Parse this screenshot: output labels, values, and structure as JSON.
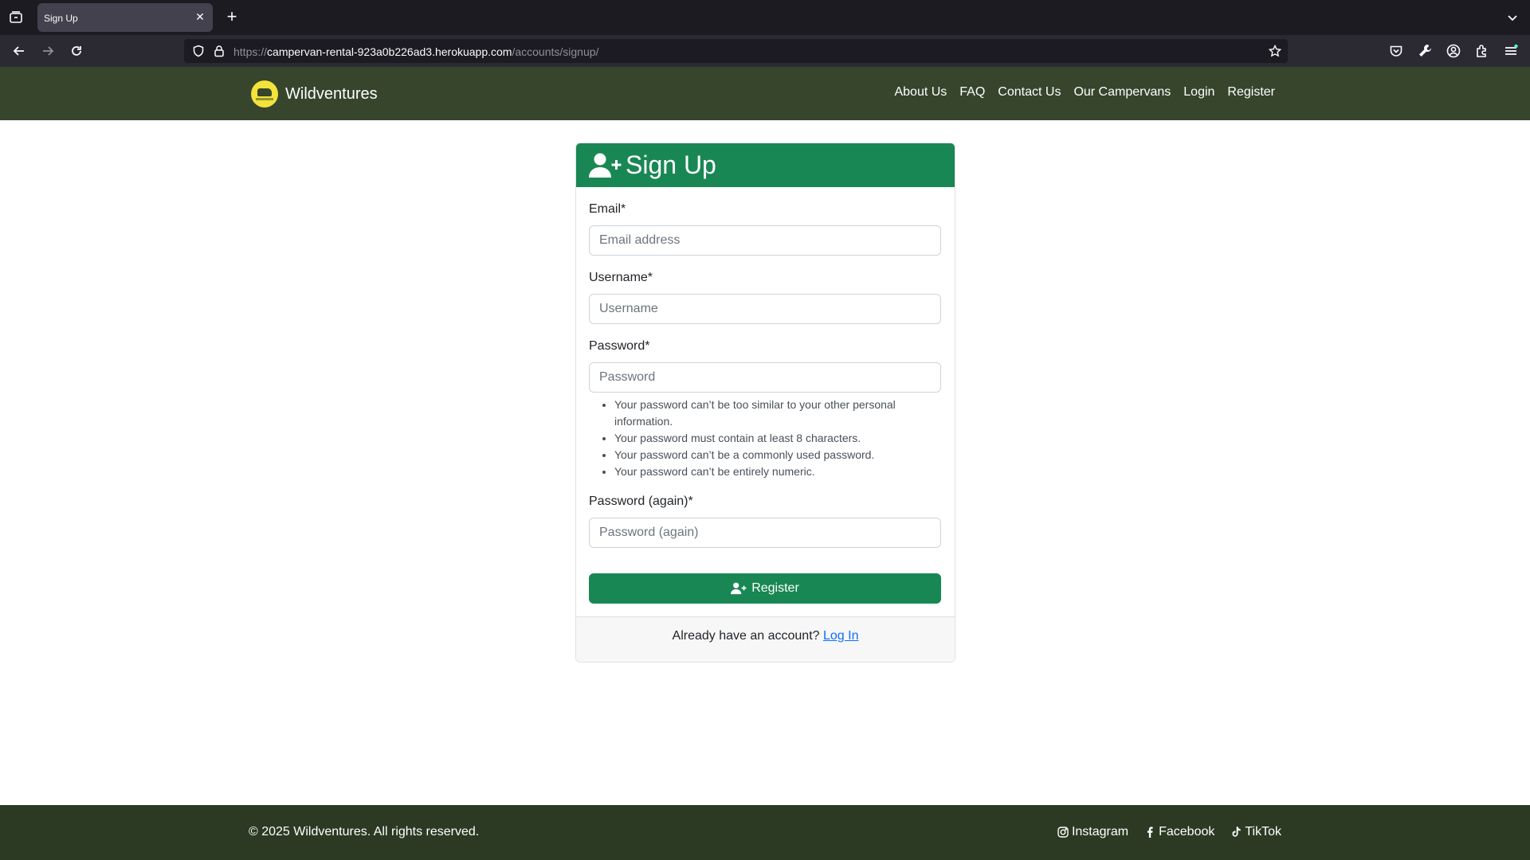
{
  "browser": {
    "tab_title": "Sign Up",
    "url_scheme": "https://",
    "url_host": "campervan-rental-923a0b226ad3.herokuapp.com",
    "url_path": "/accounts/signup/"
  },
  "header": {
    "brand": "Wildventures",
    "nav": [
      "About Us",
      "FAQ",
      "Contact Us",
      "Our Campervans",
      "Login",
      "Register"
    ]
  },
  "form": {
    "title": "Sign Up",
    "email_label": "Email*",
    "email_placeholder": "Email address",
    "username_label": "Username*",
    "username_placeholder": "Username",
    "password_label": "Password*",
    "password_placeholder": "Password",
    "password_help": [
      "Your password can’t be too similar to your other personal information.",
      "Your password must contain at least 8 characters.",
      "Your password can’t be a commonly used password.",
      "Your password can’t be entirely numeric."
    ],
    "password2_label": "Password (again)*",
    "password2_placeholder": "Password (again)",
    "submit_label": "Register",
    "footer_text": "Already have an account?",
    "login_link": "Log In"
  },
  "footer": {
    "copyright": "© 2025 Wildventures. All rights reserved.",
    "socials": [
      "Instagram",
      "Facebook",
      "TikTok"
    ]
  },
  "colors": {
    "header_bg": "#36452c",
    "footer_bg": "#2c3a24",
    "accent": "#198754",
    "link": "#0d6efd"
  }
}
